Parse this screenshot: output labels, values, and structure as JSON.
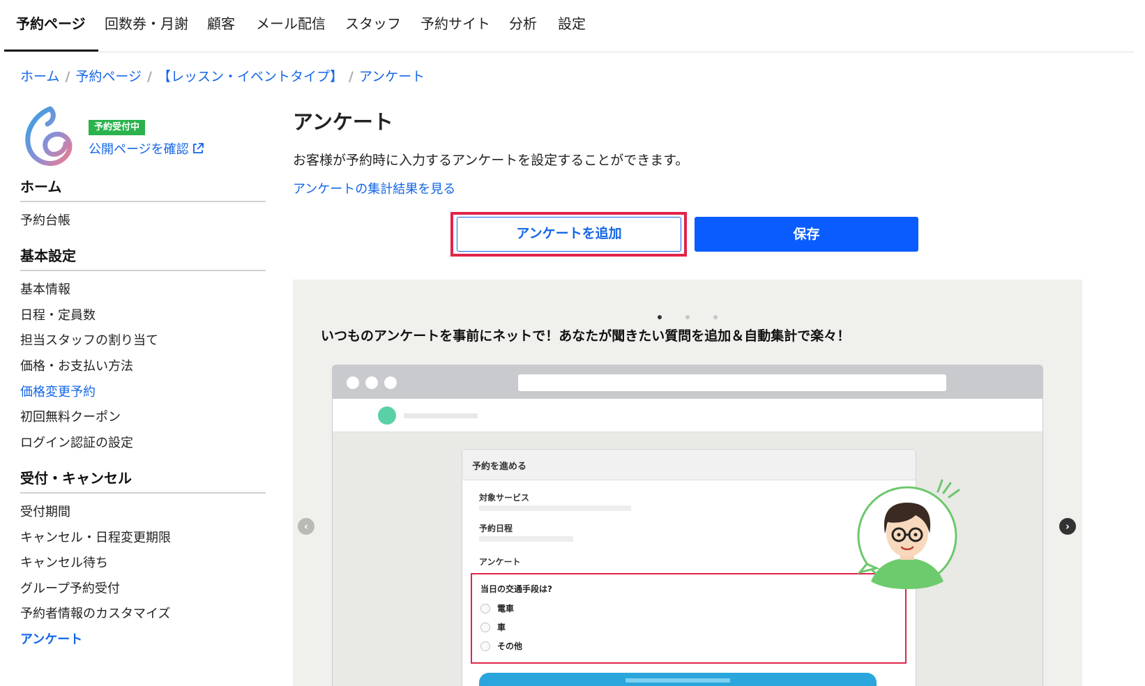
{
  "nav": {
    "tabs": [
      "予約ページ",
      "回数券・月謝",
      "顧客",
      "メール配信",
      "スタッフ",
      "予約サイト",
      "分析",
      "設定"
    ],
    "active": "予約ページ"
  },
  "breadcrumb": [
    "ホーム",
    "予約ページ",
    "【レッスン・イベントタイプ】",
    "アンケート"
  ],
  "sidebar": {
    "status_badge": "予約受付中",
    "public_link": "公開ページを確認",
    "sections": [
      {
        "title": "ホーム",
        "items": [
          "予約台帳"
        ]
      },
      {
        "title": "基本設定",
        "items": [
          "基本情報",
          "日程・定員数",
          "担当スタッフの割り当て",
          "価格・お支払い方法",
          "価格変更予約",
          "初回無料クーポン",
          "ログイン認証の設定"
        ]
      },
      {
        "title": "受付・キャンセル",
        "items": [
          "受付期間",
          "キャンセル・日程変更期限",
          "キャンセル待ち",
          "グループ予約受付",
          "予約者情報のカスタマイズ",
          "アンケート"
        ]
      }
    ],
    "link_item": "価格変更予約",
    "current_item": "アンケート"
  },
  "main": {
    "title": "アンケート",
    "description": "お客様が予約時に入力するアンケートを設定することができます。",
    "results_link": "アンケートの集計結果を見る",
    "add_button": "アンケートを追加",
    "save_button": "保存"
  },
  "carousel": {
    "slide_count": 3,
    "active_slide": 1,
    "headline": "いつものアンケートを事前にネットで！あなたが聞きたい質問を追加＆自動集計で楽々！",
    "form": {
      "header": "予約を進める",
      "fields": [
        "対象サービス",
        "予約日程",
        "アンケート"
      ],
      "question": "当日の交通手段は?",
      "options": [
        "電車",
        "車",
        "その他"
      ]
    }
  },
  "colors": {
    "link": "#1466e8",
    "primary": "#0a5cff",
    "highlight": "#e0254a",
    "badge": "#2bb24c"
  }
}
